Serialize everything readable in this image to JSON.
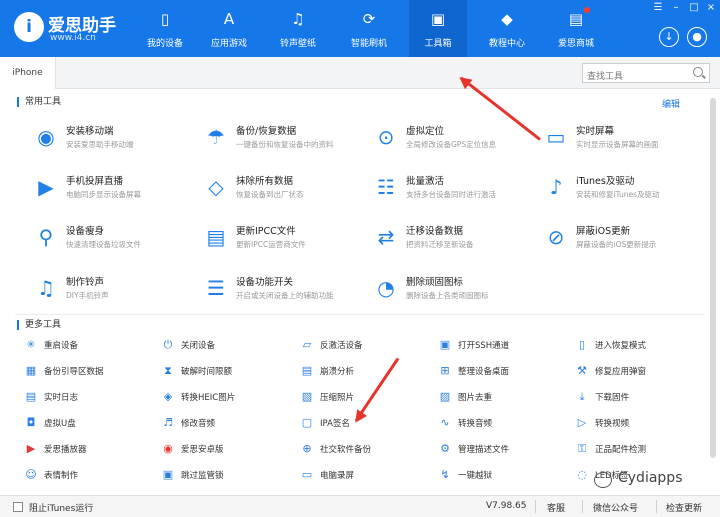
{
  "app": {
    "name": "爱思助手",
    "url": "www.i4.cn",
    "logo_mark": "i"
  },
  "nav": [
    {
      "label": "我的设备",
      "icon": "phone-icon"
    },
    {
      "label": "应用游戏",
      "icon": "apps-icon"
    },
    {
      "label": "铃声壁纸",
      "icon": "music-icon"
    },
    {
      "label": "智能刷机",
      "icon": "flash-icon"
    },
    {
      "label": "工具箱",
      "icon": "toolbox-icon",
      "active": true
    },
    {
      "label": "教程中心",
      "icon": "graduation-cap-icon"
    },
    {
      "label": "爱思商城",
      "icon": "store-icon",
      "badge": true
    }
  ],
  "tab": {
    "label": "iPhone"
  },
  "search": {
    "placeholder": "查找工具"
  },
  "common": {
    "title": "常用工具",
    "edit": "编辑",
    "tools": [
      {
        "name": "安装移动端",
        "desc": "安装爱思助手移动端",
        "icon": "i4-app-icon"
      },
      {
        "name": "备份/恢复数据",
        "desc": "一键备份和恢复设备中的资料",
        "icon": "umbrella-icon"
      },
      {
        "name": "虚拟定位",
        "desc": "全局修改设备GPS定位信息",
        "icon": "location-pin-icon"
      },
      {
        "name": "实时屏幕",
        "desc": "实时显示设备屏幕的画面",
        "icon": "screen-mirror-icon"
      },
      {
        "name": "手机投屏直播",
        "desc": "电脑同步显示设备屏幕",
        "icon": "cast-icon"
      },
      {
        "name": "抹除所有数据",
        "desc": "恢复设备到出厂状态",
        "icon": "eraser-icon"
      },
      {
        "name": "批量激活",
        "desc": "支持多台设备同时进行激活",
        "icon": "sliders-icon"
      },
      {
        "name": "iTunes及驱动",
        "desc": "安装和修复iTunes及驱动",
        "icon": "itunes-icon"
      },
      {
        "name": "设备瘦身",
        "desc": "快速清理设备垃圾文件",
        "icon": "broom-icon"
      },
      {
        "name": "更新IPCC文件",
        "desc": "更新IPCC运营商文件",
        "icon": "ipcc-file-icon"
      },
      {
        "name": "迁移设备数据",
        "desc": "把资料迁移至新设备",
        "icon": "transfer-icon"
      },
      {
        "name": "屏蔽iOS更新",
        "desc": "屏蔽设备的iOS更新提示",
        "icon": "block-update-icon"
      },
      {
        "name": "制作铃声",
        "desc": "DIY手机铃声",
        "icon": "bell-icon"
      },
      {
        "name": "设备功能开关",
        "desc": "开启或关闭设备上的辅助功能",
        "icon": "toggle-icon"
      },
      {
        "name": "删除顽固图标",
        "desc": "删除设备上各类顽固图标",
        "icon": "pie-icon"
      }
    ]
  },
  "more": {
    "title": "更多工具",
    "tools": [
      {
        "label": "重启设备",
        "icon": "restart-icon"
      },
      {
        "label": "关闭设备",
        "icon": "power-icon"
      },
      {
        "label": "反激活设备",
        "icon": "deactivate-icon"
      },
      {
        "label": "打开SSH通道",
        "icon": "terminal-icon"
      },
      {
        "label": "进入恢复模式",
        "icon": "recovery-icon"
      },
      {
        "label": "备份引导区数据",
        "icon": "backup-boot-icon"
      },
      {
        "label": "破解时间限额",
        "icon": "hourglass-icon"
      },
      {
        "label": "崩溃分析",
        "icon": "crash-analysis-icon"
      },
      {
        "label": "整理设备桌面",
        "icon": "grid-icon"
      },
      {
        "label": "修复应用弹窗",
        "icon": "repair-icon"
      },
      {
        "label": "实时日志",
        "icon": "log-icon"
      },
      {
        "label": "转换HEIC图片",
        "icon": "heic-icon"
      },
      {
        "label": "压缩照片",
        "icon": "compress-icon"
      },
      {
        "label": "图片去重",
        "icon": "dedupe-icon"
      },
      {
        "label": "下载固件",
        "icon": "download-icon"
      },
      {
        "label": "虚拟U盘",
        "icon": "usb-drive-icon"
      },
      {
        "label": "修改音频",
        "icon": "audio-edit-icon"
      },
      {
        "label": "IPA签名",
        "icon": "ipa-icon"
      },
      {
        "label": "转换音频",
        "icon": "waveform-icon"
      },
      {
        "label": "转换视频",
        "icon": "video-icon"
      },
      {
        "label": "爱思播放器",
        "icon": "player-icon"
      },
      {
        "label": "爱思安卓版",
        "icon": "android-icon"
      },
      {
        "label": "社交软件备份",
        "icon": "social-backup-icon"
      },
      {
        "label": "管理描述文件",
        "icon": "profile-icon"
      },
      {
        "label": "正品配件检测",
        "icon": "accessory-check-icon"
      },
      {
        "label": "表情制作",
        "icon": "emoji-icon"
      },
      {
        "label": "跳过监管锁",
        "icon": "lock-skip-icon"
      },
      {
        "label": "电脑录屏",
        "icon": "record-icon"
      },
      {
        "label": "一键越狱",
        "icon": "jailbreak-icon"
      },
      {
        "label": "LED标签",
        "icon": "led-icon"
      }
    ]
  },
  "footer": {
    "itunes_label": "阻止iTunes运行",
    "version": "V7.98.65",
    "support": "客服",
    "wechat": "微信公众号",
    "check_update": "检查更新"
  },
  "watermark": {
    "text": "Cydiapps"
  }
}
